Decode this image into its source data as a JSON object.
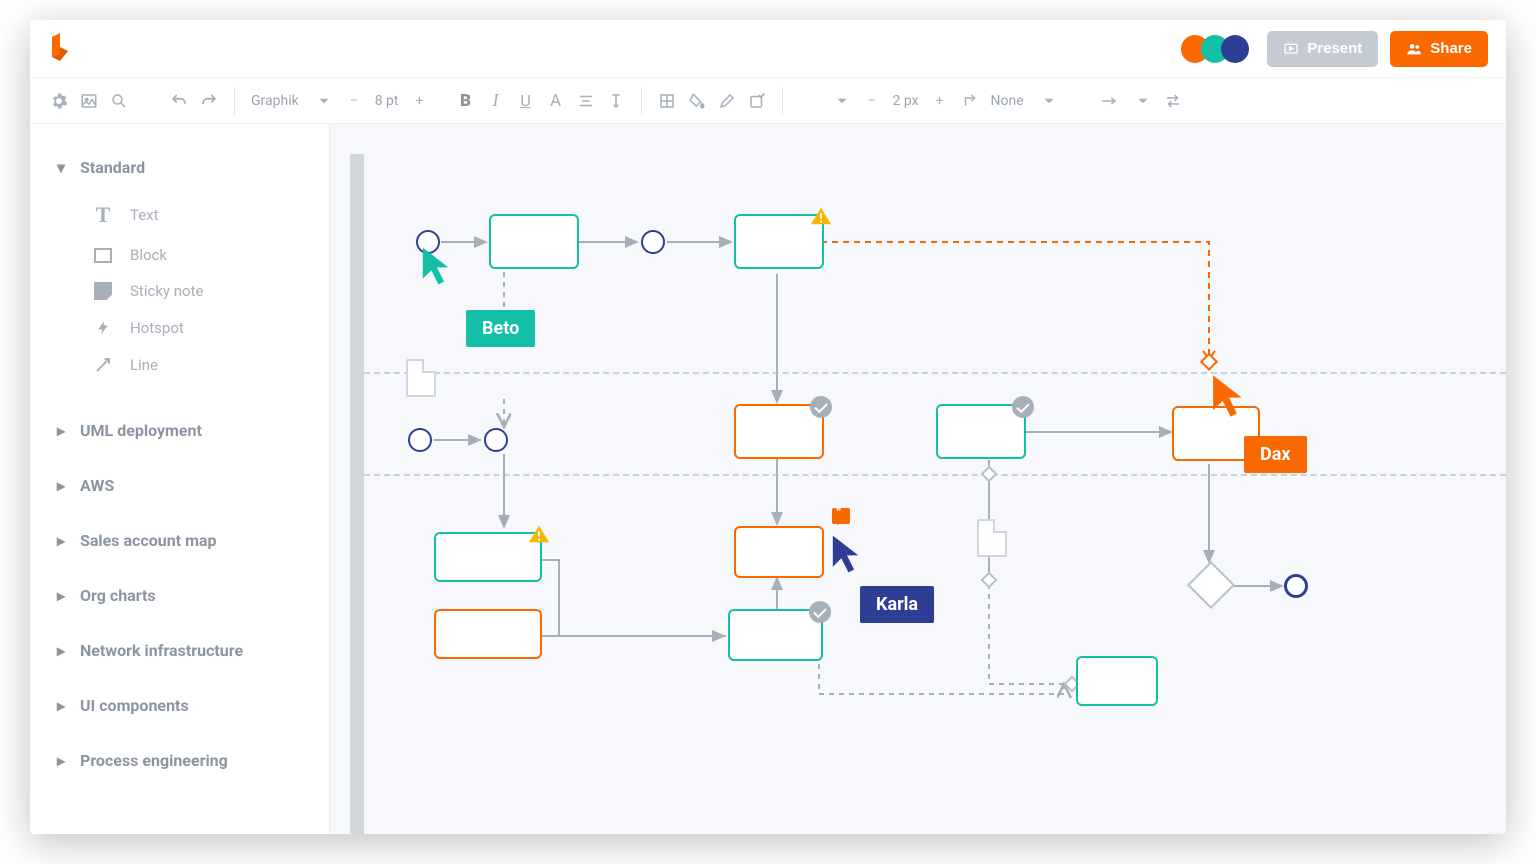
{
  "header": {
    "present_label": "Present",
    "share_label": "Share",
    "presence_colors": [
      "#fa6800",
      "#13bfa6",
      "#2d3e94"
    ]
  },
  "toolbar": {
    "font_family": "Graphik",
    "font_size": "8 pt",
    "stroke_width": "2 px",
    "line_end": "None"
  },
  "sidebar": {
    "groups": [
      {
        "label": "Standard",
        "expanded": true,
        "items": [
          {
            "label": "Text",
            "icon": "text"
          },
          {
            "label": "Block",
            "icon": "block"
          },
          {
            "label": "Sticky note",
            "icon": "sticky"
          },
          {
            "label": "Hotspot",
            "icon": "hotspot"
          },
          {
            "label": "Line",
            "icon": "line"
          }
        ]
      },
      {
        "label": "UML deployment",
        "expanded": false
      },
      {
        "label": "AWS",
        "expanded": false
      },
      {
        "label": "Sales account map",
        "expanded": false
      },
      {
        "label": "Org charts",
        "expanded": false
      },
      {
        "label": "Network infrastructure",
        "expanded": false
      },
      {
        "label": "UI components",
        "expanded": false
      },
      {
        "label": "Process engineering",
        "expanded": false
      }
    ]
  },
  "collaborators": {
    "beto": {
      "name": "Beto",
      "color": "#13bfa6"
    },
    "karla": {
      "name": "Karla",
      "color": "#2d3e94"
    },
    "dax": {
      "name": "Dax",
      "color": "#fa6800"
    }
  },
  "colors": {
    "teal": "#13bfa6",
    "navy": "#2d3e94",
    "orange": "#fa6800",
    "grey": "#a6afba"
  }
}
